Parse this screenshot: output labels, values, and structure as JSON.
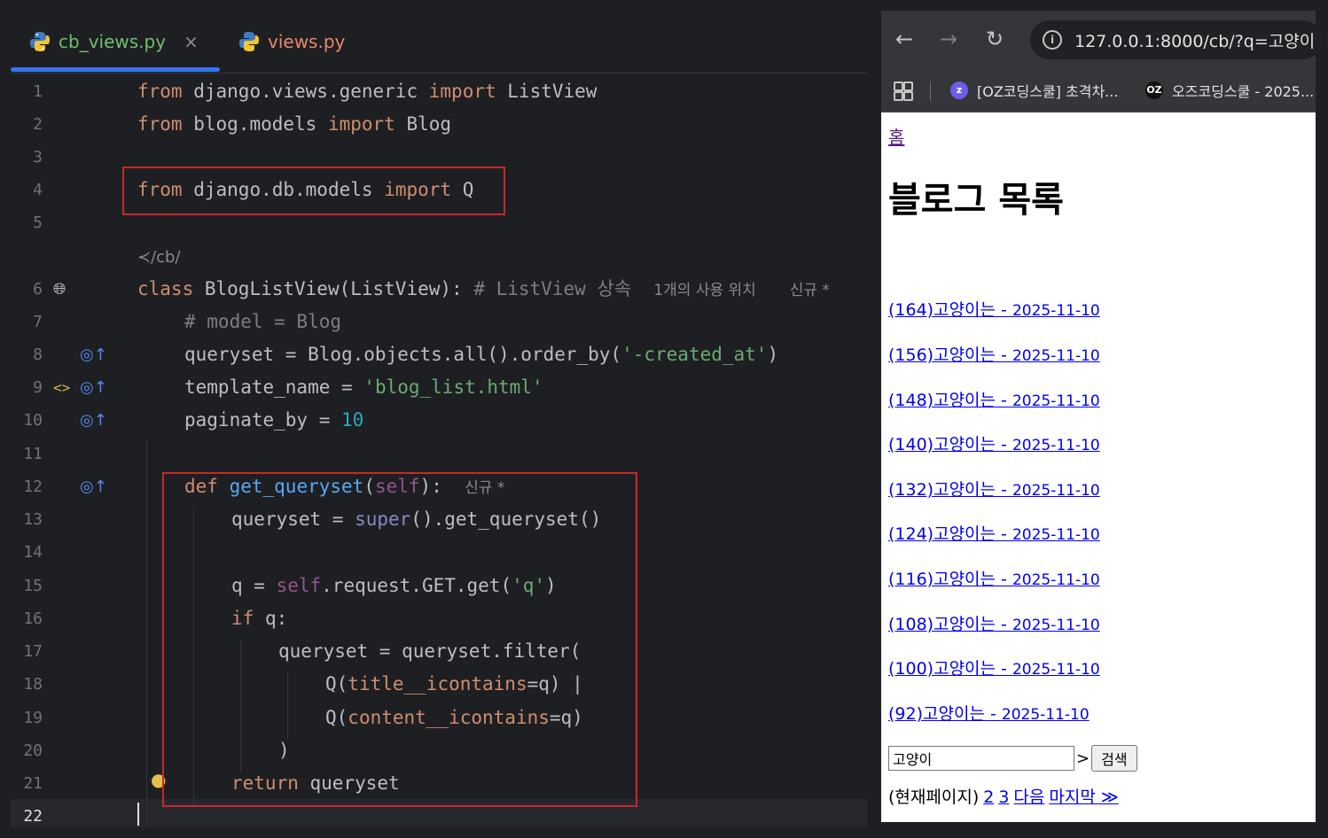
{
  "editor": {
    "tabs": [
      {
        "label": "cb_views.py",
        "active": true,
        "close": "×"
      },
      {
        "label": "views.py",
        "active": false
      }
    ],
    "line_numbers": [
      "1",
      "2",
      "3",
      "4",
      "5",
      "6",
      "7",
      "8",
      "9",
      "10",
      "11",
      "12",
      "13",
      "14",
      "15",
      "16",
      "17",
      "18",
      "19",
      "20",
      "21",
      "22"
    ],
    "current_line": "22",
    "url_hint": "/cb/",
    "code": {
      "l1": {
        "kw1": "from",
        "mod": "django.views.generic",
        "kw2": "import",
        "name": "ListView"
      },
      "l2": {
        "kw1": "from",
        "mod": "blog.models",
        "kw2": "import",
        "name": "Blog"
      },
      "l4": {
        "kw1": "from",
        "mod": "django.db.models",
        "kw2": "import",
        "name": "Q"
      },
      "l6": {
        "kw": "class",
        "name": "BlogListView(ListView):",
        "comment": "# ListView 상속",
        "hint_usage": "1개의 사용 위치",
        "hint_new": "신규 *"
      },
      "l7": {
        "comment": "# model = Blog"
      },
      "l8": {
        "a": "queryset = Blog.objects.all().order_by(",
        "s": "'-created_at'",
        "b": ")"
      },
      "l9": {
        "a": "template_name = ",
        "s": "'blog_list.html'"
      },
      "l10": {
        "a": "paginate_by = ",
        "n": "10"
      },
      "l12": {
        "kw": "def",
        "fn": "get_queryset",
        "p1": "(",
        "self": "self",
        "p2": "):",
        "hint_new": "신규 *"
      },
      "l13": {
        "a": "queryset = ",
        "bi": "super",
        "b": "().get_queryset()"
      },
      "l15": {
        "a": "q = ",
        "self": "self",
        "b": ".request.GET.get(",
        "s": "'q'",
        "c": ")"
      },
      "l16": {
        "kw": "if",
        "a": " q:"
      },
      "l17": {
        "a": "queryset = queryset.filter("
      },
      "l18": {
        "a": "Q(",
        "p": "title__icontains",
        "b": "=q) |"
      },
      "l19": {
        "a": "Q(",
        "p": "content__icontains",
        "b": "=q)"
      },
      "l20": {
        "a": ")"
      },
      "l21": {
        "kw": "return",
        "a": " queryset"
      }
    }
  },
  "browser": {
    "url": "127.0.0.1:8000/cb/?q=고양이",
    "bookmarks": [
      {
        "label": "[OZ코딩스쿨] 초격차...",
        "icon": "z"
      },
      {
        "label": "오즈코딩스쿨 - 2025...",
        "icon": "OZ"
      }
    ],
    "page": {
      "home_link": "홈",
      "heading": "블로그 목록",
      "posts": [
        {
          "title": "(164)고양이는",
          "date": "2025-11-10"
        },
        {
          "title": "(156)고양이는",
          "date": "2025-11-10"
        },
        {
          "title": "(148)고양이는",
          "date": "2025-11-10"
        },
        {
          "title": "(140)고양이는",
          "date": "2025-11-10"
        },
        {
          "title": "(132)고양이는",
          "date": "2025-11-10"
        },
        {
          "title": "(124)고양이는",
          "date": "2025-11-10"
        },
        {
          "title": "(116)고양이는",
          "date": "2025-11-10"
        },
        {
          "title": "(108)고양이는",
          "date": "2025-11-10"
        },
        {
          "title": "(100)고양이는",
          "date": "2025-11-10"
        },
        {
          "title": "(92)고양이는",
          "date": "2025-11-10"
        }
      ],
      "search": {
        "value": "고양이",
        "gt": ">",
        "button": "검색"
      },
      "pager": {
        "current": "(현재페이지)",
        "links": [
          "2",
          "3",
          "다음",
          "마지막 ≫"
        ]
      }
    }
  }
}
